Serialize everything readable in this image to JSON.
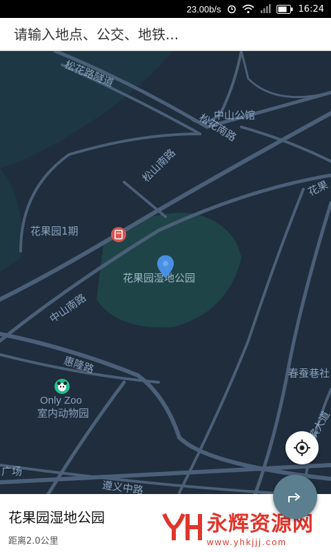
{
  "status_bar": {
    "net_speed": "23.00b/s",
    "time": "16:24"
  },
  "search": {
    "placeholder": "请输入地点、公交、地铁..."
  },
  "map": {
    "labels": {
      "songhua_tunnel": "松花路隧道",
      "zhongshan_hall": "中山公馆",
      "songhuanan_right": "松花南路",
      "songshannan": "松山南路",
      "huaguo_right": "花果",
      "huaguo_phase1": "花果园1期",
      "zhongshannan": "中山南路",
      "park": "花果园湿地公园",
      "huilong": "惠隆路",
      "chuncan": "春蚕巷社",
      "only_zoo": "Only Zoo",
      "indoor_zoo": "室内动物园",
      "zunyi": "遵义中路",
      "square": "广场",
      "river_road": "滨大道"
    },
    "colors": {
      "background": "#1f2d3d",
      "water": "#1d3a45",
      "park": "#1f4a4a",
      "road": "#4b5f78"
    }
  },
  "bottom": {
    "place_name": "花果园湿地公园",
    "distance": "距离2.0公里"
  },
  "watermark": {
    "brand": "永辉资源网",
    "url": "www.yhkjjj.com"
  },
  "icons": [
    "alarm-icon",
    "wifi-icon",
    "signal-icon",
    "battery-icon",
    "locate-icon",
    "route-icon",
    "map-pin-icon",
    "panda-icon",
    "poi-icon"
  ]
}
